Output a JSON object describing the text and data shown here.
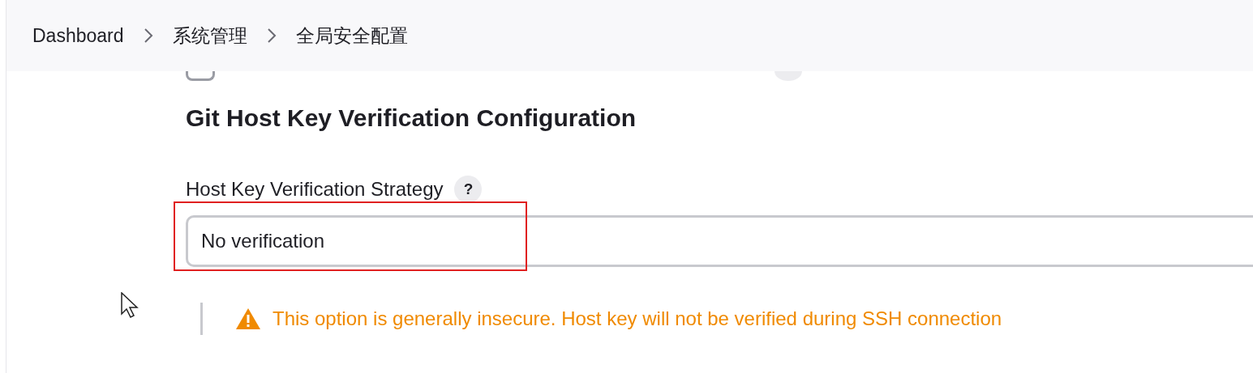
{
  "breadcrumb": [
    {
      "label": "Dashboard"
    },
    {
      "label": "系统管理"
    },
    {
      "label": "全局安全配置"
    }
  ],
  "legacy_token_option": {
    "checked": false
  },
  "section": {
    "title": "Git Host Key Verification Configuration",
    "field_label": "Host Key Verification Strategy",
    "help": "?",
    "value": "No verification",
    "highlighted": true,
    "warning": "This option is generally insecure. Host key will not be verified during SSH connection"
  }
}
